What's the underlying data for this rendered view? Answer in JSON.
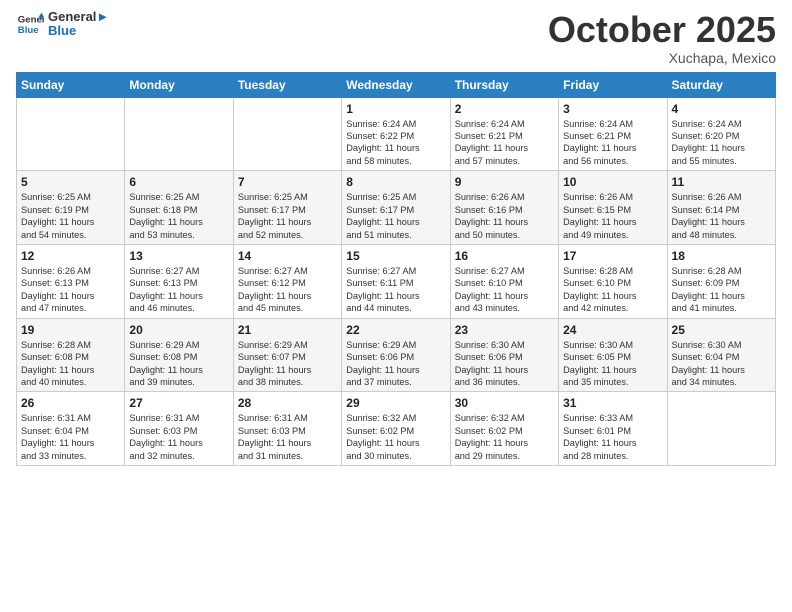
{
  "logo": {
    "line1": "General",
    "line2": "Blue"
  },
  "title": "October 2025",
  "subtitle": "Xuchapa, Mexico",
  "days": [
    "Sunday",
    "Monday",
    "Tuesday",
    "Wednesday",
    "Thursday",
    "Friday",
    "Saturday"
  ],
  "weeks": [
    [
      {
        "num": "",
        "lines": []
      },
      {
        "num": "",
        "lines": []
      },
      {
        "num": "",
        "lines": []
      },
      {
        "num": "1",
        "lines": [
          "Sunrise: 6:24 AM",
          "Sunset: 6:22 PM",
          "Daylight: 11 hours",
          "and 58 minutes."
        ]
      },
      {
        "num": "2",
        "lines": [
          "Sunrise: 6:24 AM",
          "Sunset: 6:21 PM",
          "Daylight: 11 hours",
          "and 57 minutes."
        ]
      },
      {
        "num": "3",
        "lines": [
          "Sunrise: 6:24 AM",
          "Sunset: 6:21 PM",
          "Daylight: 11 hours",
          "and 56 minutes."
        ]
      },
      {
        "num": "4",
        "lines": [
          "Sunrise: 6:24 AM",
          "Sunset: 6:20 PM",
          "Daylight: 11 hours",
          "and 55 minutes."
        ]
      }
    ],
    [
      {
        "num": "5",
        "lines": [
          "Sunrise: 6:25 AM",
          "Sunset: 6:19 PM",
          "Daylight: 11 hours",
          "and 54 minutes."
        ]
      },
      {
        "num": "6",
        "lines": [
          "Sunrise: 6:25 AM",
          "Sunset: 6:18 PM",
          "Daylight: 11 hours",
          "and 53 minutes."
        ]
      },
      {
        "num": "7",
        "lines": [
          "Sunrise: 6:25 AM",
          "Sunset: 6:17 PM",
          "Daylight: 11 hours",
          "and 52 minutes."
        ]
      },
      {
        "num": "8",
        "lines": [
          "Sunrise: 6:25 AM",
          "Sunset: 6:17 PM",
          "Daylight: 11 hours",
          "and 51 minutes."
        ]
      },
      {
        "num": "9",
        "lines": [
          "Sunrise: 6:26 AM",
          "Sunset: 6:16 PM",
          "Daylight: 11 hours",
          "and 50 minutes."
        ]
      },
      {
        "num": "10",
        "lines": [
          "Sunrise: 6:26 AM",
          "Sunset: 6:15 PM",
          "Daylight: 11 hours",
          "and 49 minutes."
        ]
      },
      {
        "num": "11",
        "lines": [
          "Sunrise: 6:26 AM",
          "Sunset: 6:14 PM",
          "Daylight: 11 hours",
          "and 48 minutes."
        ]
      }
    ],
    [
      {
        "num": "12",
        "lines": [
          "Sunrise: 6:26 AM",
          "Sunset: 6:13 PM",
          "Daylight: 11 hours",
          "and 47 minutes."
        ]
      },
      {
        "num": "13",
        "lines": [
          "Sunrise: 6:27 AM",
          "Sunset: 6:13 PM",
          "Daylight: 11 hours",
          "and 46 minutes."
        ]
      },
      {
        "num": "14",
        "lines": [
          "Sunrise: 6:27 AM",
          "Sunset: 6:12 PM",
          "Daylight: 11 hours",
          "and 45 minutes."
        ]
      },
      {
        "num": "15",
        "lines": [
          "Sunrise: 6:27 AM",
          "Sunset: 6:11 PM",
          "Daylight: 11 hours",
          "and 44 minutes."
        ]
      },
      {
        "num": "16",
        "lines": [
          "Sunrise: 6:27 AM",
          "Sunset: 6:10 PM",
          "Daylight: 11 hours",
          "and 43 minutes."
        ]
      },
      {
        "num": "17",
        "lines": [
          "Sunrise: 6:28 AM",
          "Sunset: 6:10 PM",
          "Daylight: 11 hours",
          "and 42 minutes."
        ]
      },
      {
        "num": "18",
        "lines": [
          "Sunrise: 6:28 AM",
          "Sunset: 6:09 PM",
          "Daylight: 11 hours",
          "and 41 minutes."
        ]
      }
    ],
    [
      {
        "num": "19",
        "lines": [
          "Sunrise: 6:28 AM",
          "Sunset: 6:08 PM",
          "Daylight: 11 hours",
          "and 40 minutes."
        ]
      },
      {
        "num": "20",
        "lines": [
          "Sunrise: 6:29 AM",
          "Sunset: 6:08 PM",
          "Daylight: 11 hours",
          "and 39 minutes."
        ]
      },
      {
        "num": "21",
        "lines": [
          "Sunrise: 6:29 AM",
          "Sunset: 6:07 PM",
          "Daylight: 11 hours",
          "and 38 minutes."
        ]
      },
      {
        "num": "22",
        "lines": [
          "Sunrise: 6:29 AM",
          "Sunset: 6:06 PM",
          "Daylight: 11 hours",
          "and 37 minutes."
        ]
      },
      {
        "num": "23",
        "lines": [
          "Sunrise: 6:30 AM",
          "Sunset: 6:06 PM",
          "Daylight: 11 hours",
          "and 36 minutes."
        ]
      },
      {
        "num": "24",
        "lines": [
          "Sunrise: 6:30 AM",
          "Sunset: 6:05 PM",
          "Daylight: 11 hours",
          "and 35 minutes."
        ]
      },
      {
        "num": "25",
        "lines": [
          "Sunrise: 6:30 AM",
          "Sunset: 6:04 PM",
          "Daylight: 11 hours",
          "and 34 minutes."
        ]
      }
    ],
    [
      {
        "num": "26",
        "lines": [
          "Sunrise: 6:31 AM",
          "Sunset: 6:04 PM",
          "Daylight: 11 hours",
          "and 33 minutes."
        ]
      },
      {
        "num": "27",
        "lines": [
          "Sunrise: 6:31 AM",
          "Sunset: 6:03 PM",
          "Daylight: 11 hours",
          "and 32 minutes."
        ]
      },
      {
        "num": "28",
        "lines": [
          "Sunrise: 6:31 AM",
          "Sunset: 6:03 PM",
          "Daylight: 11 hours",
          "and 31 minutes."
        ]
      },
      {
        "num": "29",
        "lines": [
          "Sunrise: 6:32 AM",
          "Sunset: 6:02 PM",
          "Daylight: 11 hours",
          "and 30 minutes."
        ]
      },
      {
        "num": "30",
        "lines": [
          "Sunrise: 6:32 AM",
          "Sunset: 6:02 PM",
          "Daylight: 11 hours",
          "and 29 minutes."
        ]
      },
      {
        "num": "31",
        "lines": [
          "Sunrise: 6:33 AM",
          "Sunset: 6:01 PM",
          "Daylight: 11 hours",
          "and 28 minutes."
        ]
      },
      {
        "num": "",
        "lines": []
      }
    ]
  ]
}
